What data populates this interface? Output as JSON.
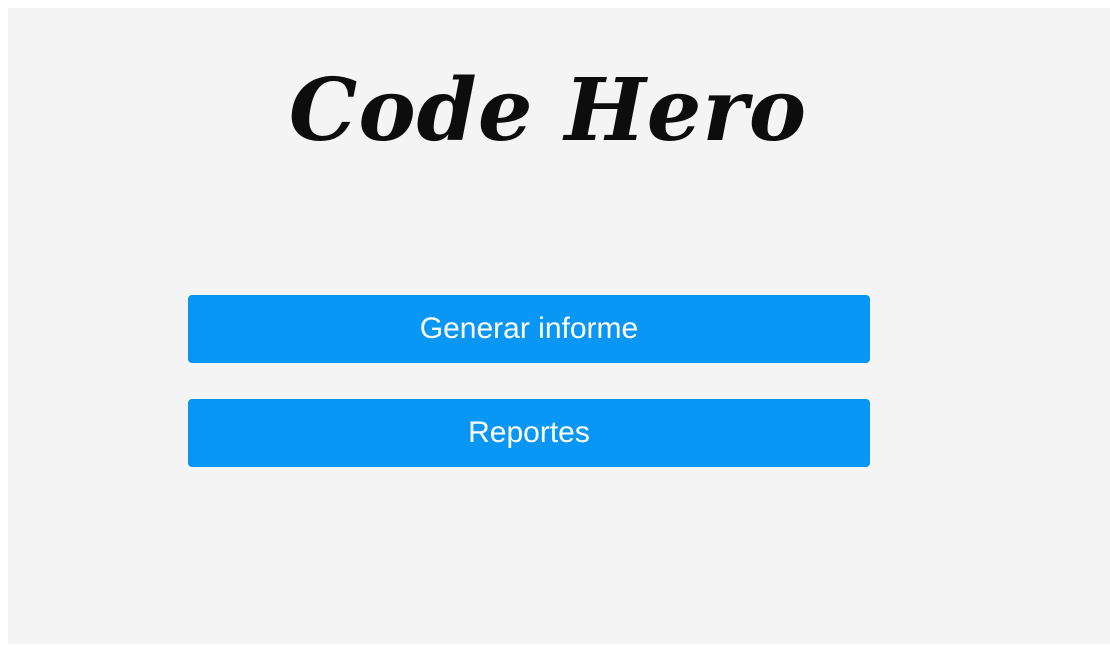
{
  "app": {
    "title": "Code Hero"
  },
  "actions": {
    "generate_report_label": "Generar informe",
    "reports_label": "Reportes"
  },
  "colors": {
    "page_background": "#f4f4f5",
    "button_background": "#0996f5",
    "button_text": "#ffffff",
    "title_text": "#0d0d0d"
  }
}
